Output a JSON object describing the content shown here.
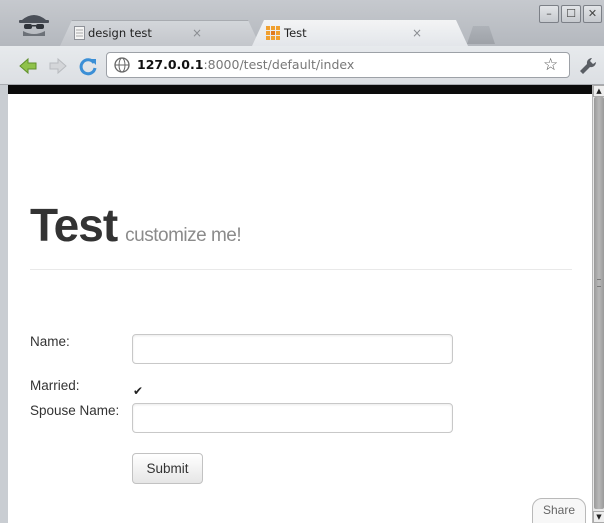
{
  "browser": {
    "tabs": [
      {
        "label": "design test",
        "close": "×"
      },
      {
        "label": "Test",
        "close": "×"
      }
    ],
    "window_buttons": {
      "minimize": "–",
      "maximize": "☐",
      "close": "✕"
    },
    "url_host": "127.0.0.1",
    "url_rest": ":8000/test/default/index",
    "star": "☆"
  },
  "page": {
    "title": "Test",
    "subtitle": "customize me!",
    "form": {
      "name_label": "Name:",
      "name_value": "",
      "married_label": "Married:",
      "married_checked": true,
      "check_mark": "✔",
      "spouse_label": "Spouse Name:",
      "spouse_value": "",
      "submit_label": "Submit"
    },
    "share_label": "Share"
  },
  "scrollbar": {
    "up": "▲",
    "down": "▼"
  },
  "colors": {
    "accent_tab": "#f0a030",
    "title_text": "#333333",
    "subtitle_text": "#8b8b8b"
  }
}
